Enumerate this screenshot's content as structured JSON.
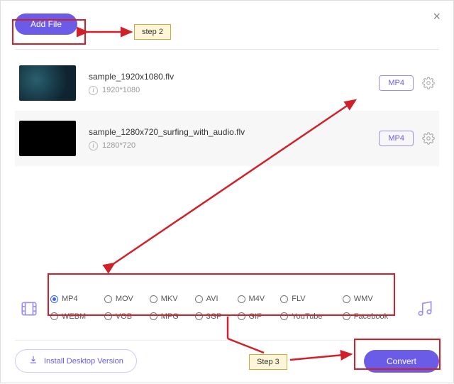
{
  "close_label": "×",
  "header": {
    "add_file_label": "Add File"
  },
  "files": [
    {
      "name": "sample_1920x1080.flv",
      "res": "1920*1080",
      "format": "MP4"
    },
    {
      "name": "sample_1280x720_surfing_with_audio.flv",
      "res": "1280*720",
      "format": "MP4"
    }
  ],
  "formats": {
    "row1": [
      "MP4",
      "MOV",
      "MKV",
      "AVI",
      "M4V",
      "FLV",
      "WMV"
    ],
    "row2": [
      "WEBM",
      "VOB",
      "MPG",
      "3GP",
      "GIF",
      "YouTube",
      "Facebook"
    ],
    "selected": "MP4"
  },
  "footer": {
    "desktop_label": "Install Desktop Version",
    "convert_label": "Convert"
  },
  "annotations": {
    "step2": "step 2",
    "step3": "Step 3"
  }
}
